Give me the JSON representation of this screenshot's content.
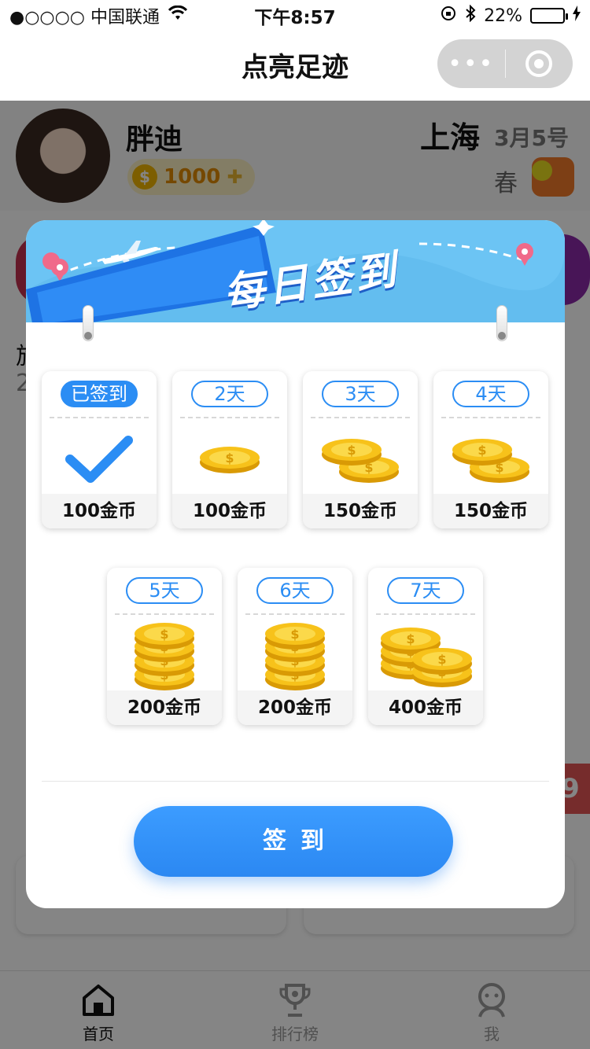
{
  "status_bar": {
    "carrier": "●○○○○ 中国联通",
    "time": "下午8:57",
    "battery": "22%",
    "battery_level": 0.22
  },
  "nav": {
    "title": "点亮足迹",
    "more_label": "•••"
  },
  "profile": {
    "name": "胖迪",
    "coins": "1000",
    "city": "上海",
    "date": "3月5号",
    "season": "春"
  },
  "background": {
    "text1": "旅",
    "text2": "2",
    "red_tab": "9"
  },
  "modal": {
    "title": "每日签到",
    "days": [
      {
        "tag": "已签到",
        "reward": "100金币",
        "status": "signed",
        "coin_stack": 0
      },
      {
        "tag": "2天",
        "reward": "100金币",
        "status": "pending",
        "coin_stack": 1
      },
      {
        "tag": "3天",
        "reward": "150金币",
        "status": "pending",
        "coin_stack": 2
      },
      {
        "tag": "4天",
        "reward": "150金币",
        "status": "pending",
        "coin_stack": 2
      },
      {
        "tag": "5天",
        "reward": "200金币",
        "status": "pending",
        "coin_stack": 3
      },
      {
        "tag": "6天",
        "reward": "200金币",
        "status": "pending",
        "coin_stack": 3
      },
      {
        "tag": "7天",
        "reward": "400金币",
        "status": "pending",
        "coin_stack": 4
      }
    ],
    "sign_button": "签到"
  },
  "tabbar": {
    "items": [
      {
        "label": "首页",
        "icon": "home-icon",
        "active": true
      },
      {
        "label": "排行榜",
        "icon": "trophy-icon",
        "active": false
      },
      {
        "label": "我",
        "icon": "person-icon",
        "active": false
      }
    ]
  },
  "colors": {
    "accent": "#2b8df4",
    "header_sky": "#6cc4f4",
    "coin": "#f7c21a"
  }
}
